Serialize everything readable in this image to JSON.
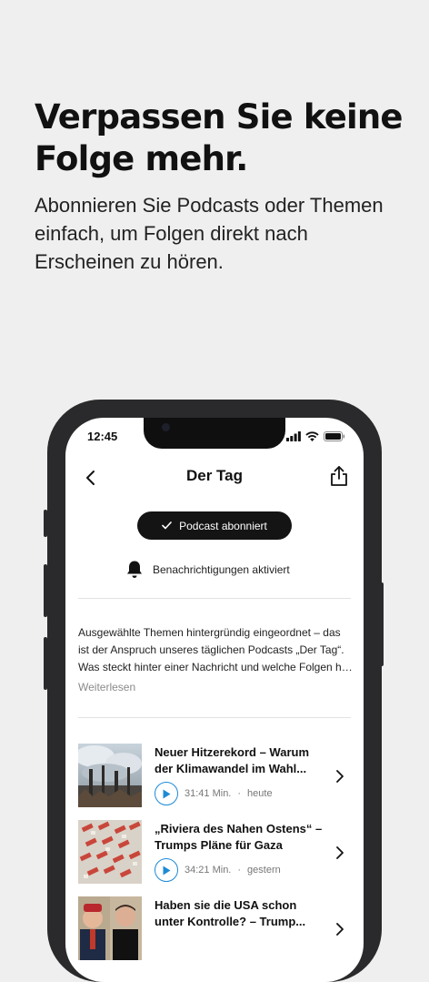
{
  "promo": {
    "headline": "Verpassen Sie keine Folge mehr.",
    "subline": "Abonnieren Sie Podcasts oder Themen einfach, um Folgen direkt nach Erscheinen zu hören."
  },
  "status_bar": {
    "time": "12:45"
  },
  "nav": {
    "title": "Der Tag"
  },
  "subscribe": {
    "label": "Podcast abonniert"
  },
  "notifications": {
    "label": "Benachrichtigungen aktiviert"
  },
  "description": {
    "text": "Ausgewählte Themen hintergründig eingeordnet – das ist der Anspruch unseres täglichen Podcasts „Der Tag“. Was steckt hinter einer Nachricht und welche Folgen hat sie für uns alle?",
    "read_more": "Weiterlesen"
  },
  "episodes": [
    {
      "title": "Neuer Hitzerekord – Warum der Klimawandel im Wahl...",
      "duration": "31:41 Min.",
      "date": "heute"
    },
    {
      "title": "„Riviera des Nahen Ostens“ – Trumps Pläne für Gaza",
      "duration": "34:21 Min.",
      "date": "gestern"
    },
    {
      "title": "Haben sie die USA schon unter Kontrolle? – Trump...",
      "duration": "",
      "date": ""
    }
  ],
  "colors": {
    "accent": "#1d8ad6",
    "button": "#141414",
    "background": "#efefef"
  },
  "icons": [
    "back-chevron-icon",
    "share-icon",
    "check-icon",
    "bell-icon",
    "play-icon",
    "chevron-right-icon"
  ]
}
